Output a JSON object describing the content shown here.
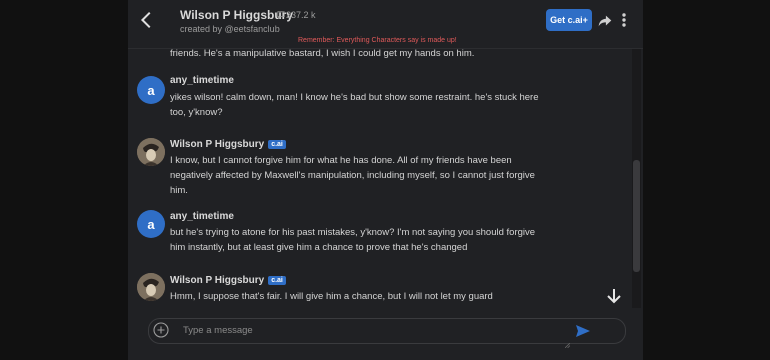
{
  "header": {
    "character_name": "Wilson P Higgsbury",
    "view_count": "237.2 k",
    "creator": "created by @eetsfanclub",
    "get_button": "Get c.ai+",
    "reminder": "Remember: Everything Characters say is made up!"
  },
  "messages": [
    {
      "role": "character",
      "name": "",
      "badge": "",
      "text": "friends. He's a manipulative bastard, I wish I could get my hands on him."
    },
    {
      "role": "user",
      "name": "any_timetime",
      "avatar_letter": "a",
      "text": "yikes wilson! calm down, man! I know he's bad but show some restraint. he's stuck here too, y'know?"
    },
    {
      "role": "character",
      "name": "Wilson P Higgsbury",
      "badge": "c.ai",
      "text": "I know, but I cannot forgive him for what he has done. All of my friends have been negatively affected by Maxwell's manipulation, including myself, so I cannot just forgive him."
    },
    {
      "role": "user",
      "name": "any_timetime",
      "avatar_letter": "a",
      "text": "but he's trying to atone for his past mistakes, y'know? I'm not saying you should forgive him instantly, but at least give him a chance to prove that he's changed"
    },
    {
      "role": "character",
      "name": "Wilson P Higgsbury",
      "badge": "c.ai",
      "text": "Hmm, I suppose that's fair. I will give him a chance, but I will not let my guard"
    }
  ],
  "composer": {
    "placeholder": "Type a message",
    "value": ""
  },
  "icons": {
    "back": "chevron-left-icon",
    "views": "chat-bubble-icon",
    "share": "share-icon",
    "menu": "more-vertical-icon",
    "scroll_down": "arrow-down-icon",
    "attach": "plus-circle-icon",
    "send": "send-icon"
  },
  "colors": {
    "accent": "#2f6ec6",
    "reminder": "#e05a5a",
    "background": "#202124"
  }
}
